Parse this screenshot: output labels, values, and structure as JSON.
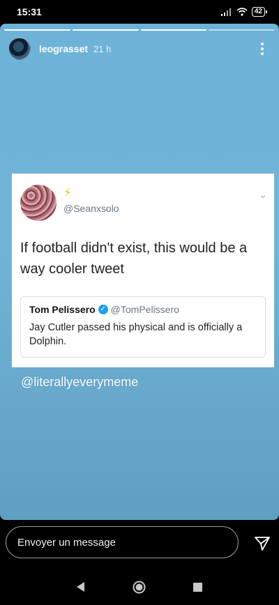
{
  "status_bar": {
    "time": "15:31",
    "battery": "42"
  },
  "story": {
    "username": "leograsset",
    "time_ago": "21 h",
    "progress_segments": 4,
    "progress_active": 3,
    "caption": "@literallyeverymeme"
  },
  "tweet": {
    "emoji": "⚡",
    "handle": "@Seanxsolo",
    "text": "If football didn't exist, this would be a way cooler tweet",
    "quote": {
      "name": "Tom Pelissero",
      "handle": "@TomPelissero",
      "text": "Jay Cutler passed his physical and is officially a Dolphin."
    }
  },
  "reply": {
    "placeholder": "Envoyer un message"
  },
  "icons": {
    "more": "more-vertical-icon",
    "send": "send-icon",
    "back": "back-icon",
    "home": "home-icon",
    "recents": "recents-icon"
  },
  "colors": {
    "story_bg": "#6db3d8",
    "verified": "#1da1f2"
  }
}
